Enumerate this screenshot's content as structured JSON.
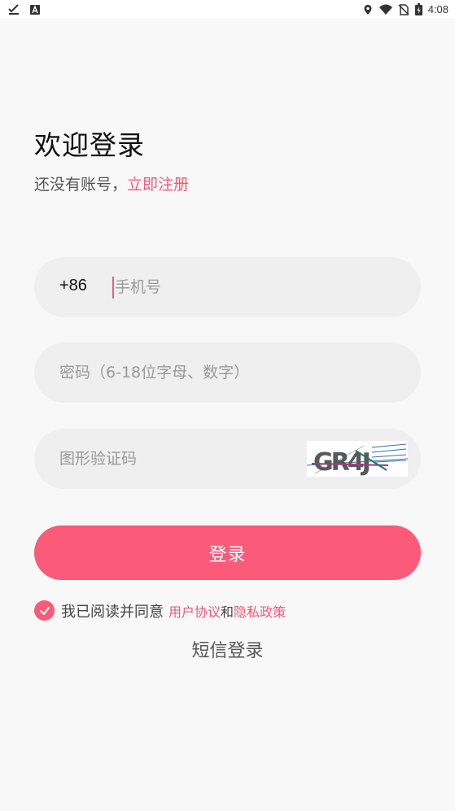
{
  "status_bar": {
    "time": "4:08",
    "left_icons": [
      "check-download-icon",
      "keyboard-a-icon"
    ],
    "right_icons": [
      "location-pin-icon",
      "wifi-icon",
      "no-sim-icon",
      "battery-charging-icon"
    ]
  },
  "header": {
    "title": "欢迎登录",
    "subtitle_prefix": "还没有账号，",
    "register_link": "立即注册"
  },
  "form": {
    "phone": {
      "country_code": "+86",
      "placeholder": "手机号",
      "value": ""
    },
    "password": {
      "placeholder": "密码（6-18位字母、数字）",
      "value": ""
    },
    "captcha": {
      "placeholder": "图形验证码",
      "value": "",
      "image_text": "GR4J"
    },
    "login_button": "登录"
  },
  "agreement": {
    "checked": true,
    "prefix": "我已阅读并同意",
    "user_agreement": "用户协议",
    "and": "和",
    "privacy_policy": "隐私政策"
  },
  "sms_login": "短信登录",
  "colors": {
    "accent": "#fb5b78",
    "link": "#f05a78",
    "background": "#f8f8f8",
    "field_background": "#efefef"
  }
}
